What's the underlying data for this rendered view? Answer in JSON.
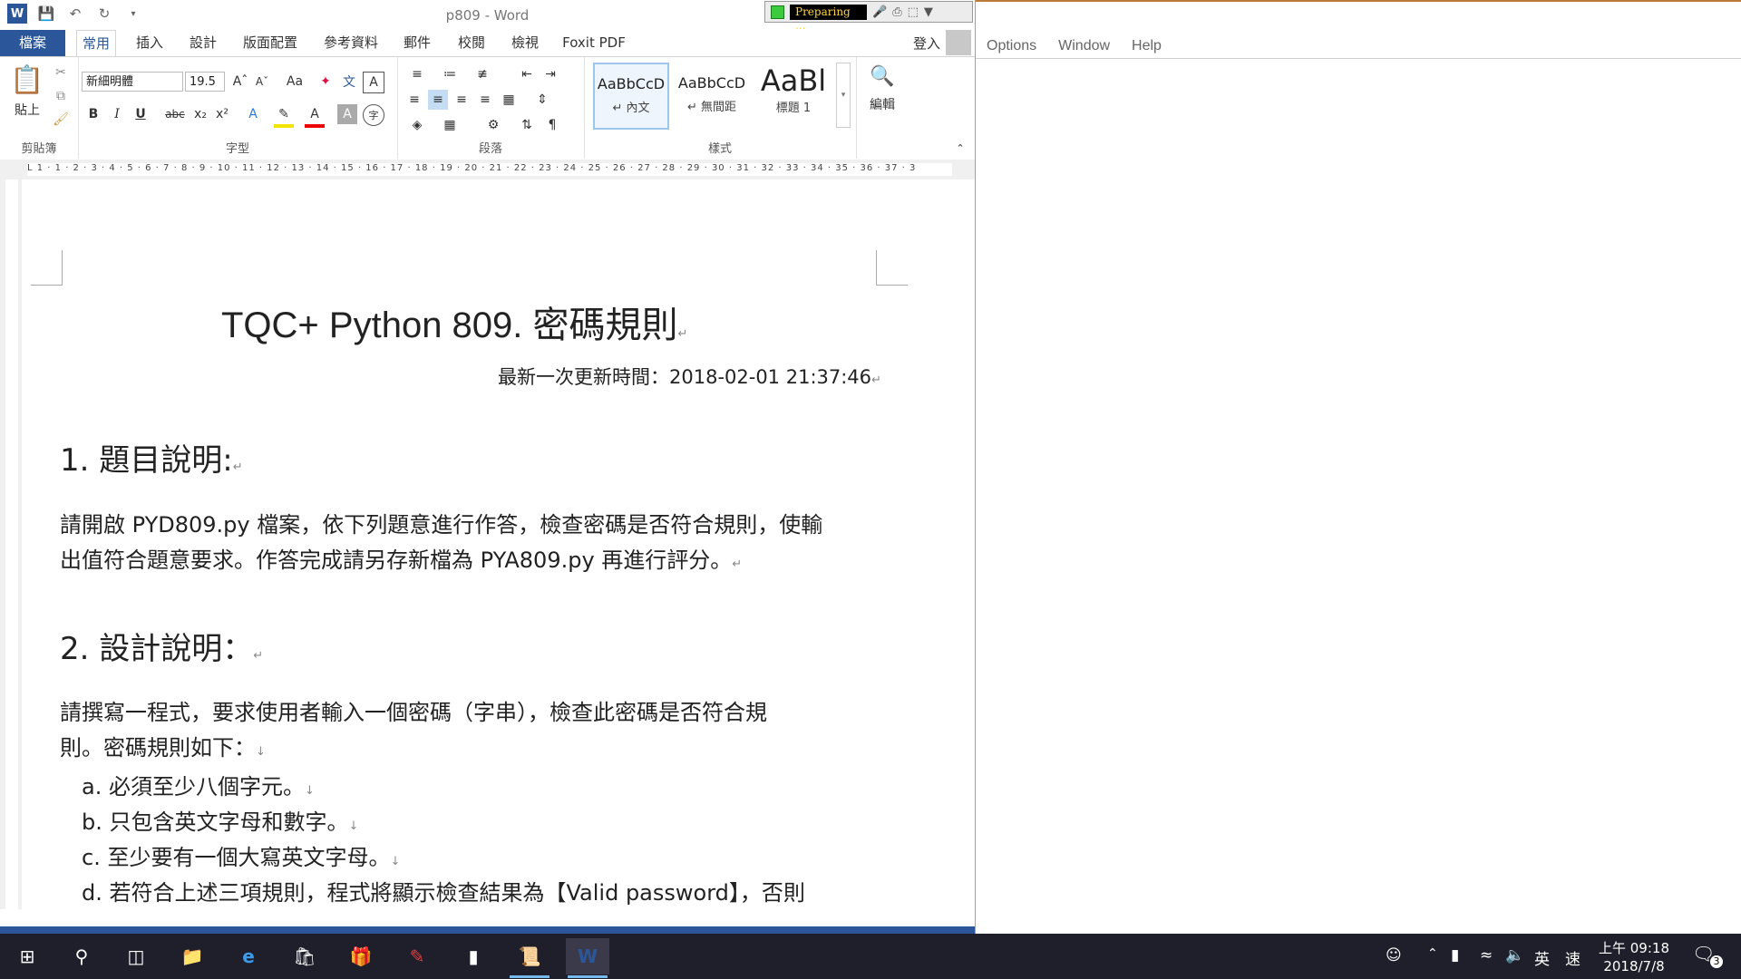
{
  "window": {
    "title": "p809 - Word",
    "recorder_status": "Preparing ..."
  },
  "tabs": [
    "檔案",
    "常用",
    "插入",
    "設計",
    "版面配置",
    "參考資料",
    "郵件",
    "校閱",
    "檢視",
    "Foxit PDF"
  ],
  "signin": "登入",
  "ribbon": {
    "clipboard": {
      "paste": "貼上",
      "label": "剪貼簿"
    },
    "font": {
      "name": "新細明體",
      "size": "19.5",
      "label": "字型"
    },
    "paragraph": {
      "label": "段落"
    },
    "styles": {
      "label": "樣式",
      "items": [
        {
          "preview": "AaBbCcD",
          "name": "↵ 內文"
        },
        {
          "preview": "AaBbCcD",
          "name": "↵ 無間距"
        },
        {
          "preview": "AaBl",
          "name": "標題 1"
        }
      ]
    },
    "editing": {
      "label": "編輯"
    }
  },
  "ruler": {
    "marks": "L   1 · 1 · 2 · 3 · 4 · 5 · 6 · 7 · 8 · 9 · 10 · 11 · 12 · 13 · 14 · 15 · 16 · 17 · 18 · 19 · 20 · 21 · 22 · 23 · 24 · 25 · 26 · 27 · 28 · 29 · 30 · 31 · 32 · 33 · 34 · 35 · 36 · 37 · 3"
  },
  "document": {
    "title": "TQC+ Python 809.  密碼規則",
    "updated": "最新一次更新時間：2018-02-01 21:37:46",
    "section1_heading": "1.  題目說明:",
    "section1_line1": "請開啟 PYD809.py 檔案，依下列題意進行作答，檢查密碼是否符合規則，使輸",
    "section1_line2": "出值符合題意要求。作答完成請另存新檔為 PYA809.py 再進行評分。",
    "section2_heading": "2.  設計說明：",
    "section2_line1": "請撰寫一程式，要求使用者輸入一個密碼（字串），檢查此密碼是否符合規",
    "section2_line2": "則。密碼規則如下：",
    "rules": [
      "a.  必須至少八個字元。",
      "b.  只包含英文字母和數字。",
      "c.  至少要有一個大寫英文字母。",
      "d.  若符合上述三項規則，程式將顯示檢查結果為【Valid password】，否則"
    ]
  },
  "right_app": {
    "menu": [
      "Options",
      "Window",
      "Help"
    ]
  },
  "taskbar": {
    "ime_lang": "英",
    "ime_mode": "速",
    "time": "上午 09:18",
    "date": "2018/7/8",
    "notifications": "3"
  }
}
